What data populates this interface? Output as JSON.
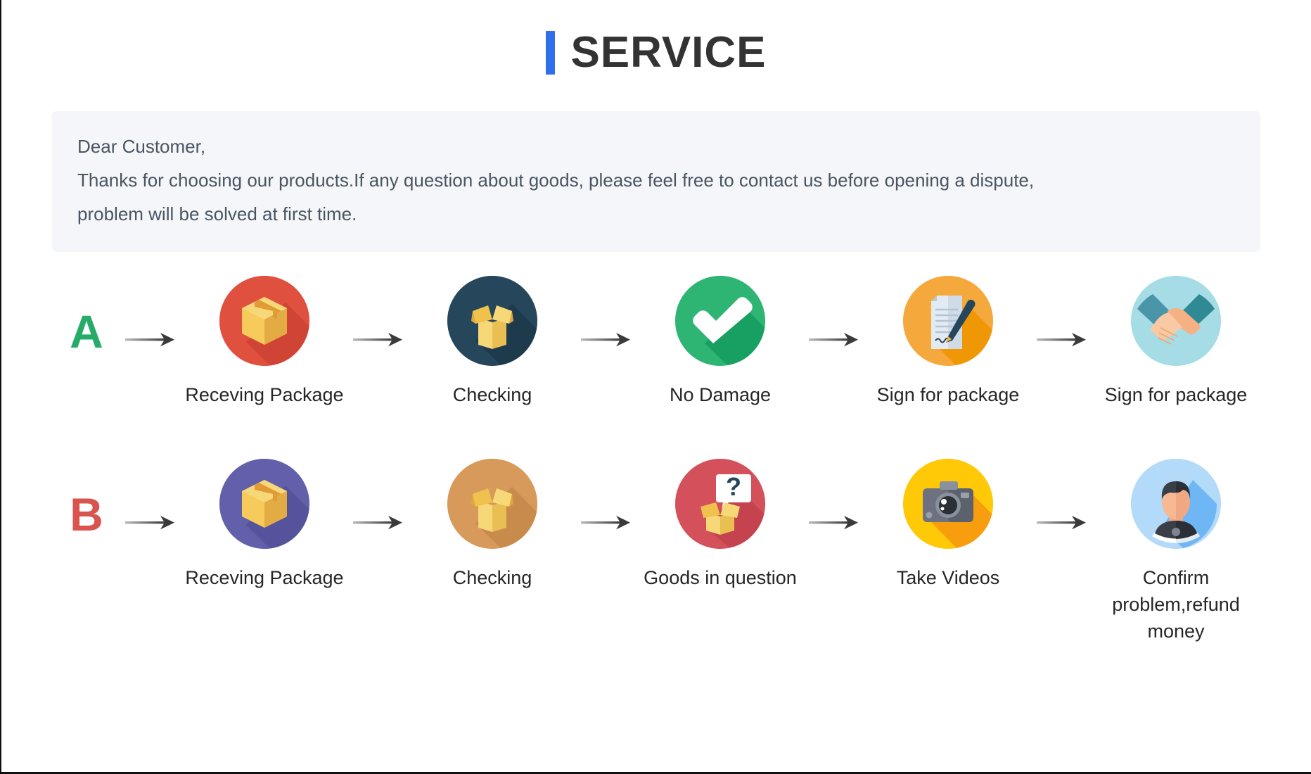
{
  "header": {
    "accent_color": "#2f6fed",
    "title": "SERVICE"
  },
  "notice": {
    "background_color": "#f4f6fa",
    "lines": [
      "Dear Customer,",
      "Thanks for choosing our products.If any question about goods, please feel free to contact us before opening a dispute,",
      "problem will be solved at first time."
    ]
  },
  "flows": [
    {
      "letter": "A",
      "letter_color": "#27ab68",
      "steps": [
        {
          "label": "Receving Package",
          "icon": "package-box-icon",
          "circle_color": "#e0503f"
        },
        {
          "label": "Checking",
          "icon": "open-box-icon",
          "circle_color": "#26465c"
        },
        {
          "label": "No Damage",
          "icon": "checkmark-icon",
          "circle_color": "#2fb573"
        },
        {
          "label": "Sign for package",
          "icon": "document-pen-icon",
          "circle_color": "#f5a83c"
        },
        {
          "label": "Sign for package",
          "icon": "handshake-icon",
          "circle_color": "#a6dce5"
        }
      ]
    },
    {
      "letter": "B",
      "letter_color": "#d9534f",
      "steps": [
        {
          "label": "Receving Package",
          "icon": "package-box-icon",
          "circle_color": "#6260ab"
        },
        {
          "label": "Checking",
          "icon": "open-box-icon",
          "circle_color": "#d79a5b"
        },
        {
          "label": "Goods in question",
          "icon": "question-box-icon",
          "circle_color": "#d4505a"
        },
        {
          "label": "Take Videos",
          "icon": "camera-icon",
          "circle_color": "#ffc907"
        },
        {
          "label": "Confirm problem,refund money",
          "icon": "support-person-icon",
          "circle_color": "#9ed0f7"
        }
      ]
    }
  ]
}
